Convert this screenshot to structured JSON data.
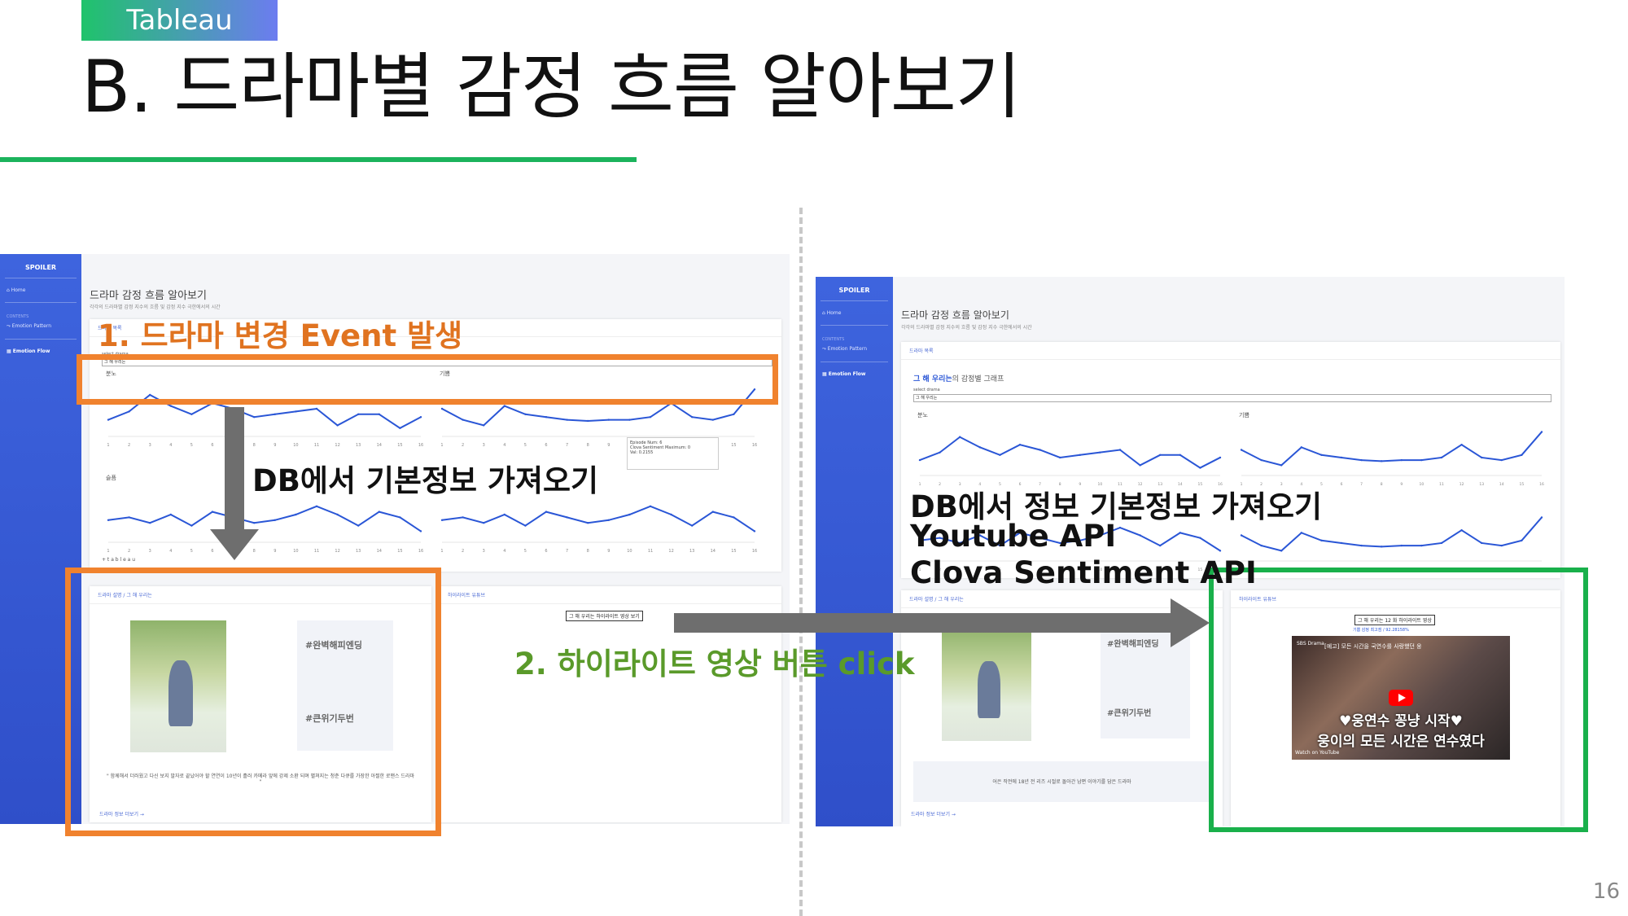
{
  "header": {
    "tag": "Tableau",
    "title": "B. 드라마별 감정 흐름 알아보기",
    "page_number": "16"
  },
  "left_dashboard": {
    "brand": "SPOILER",
    "nav": [
      "Home",
      "CONTENTS",
      "Emotion Pattern",
      "Emotion Flow"
    ],
    "page_title": "드라마 감정 흐름 알아보기",
    "page_subtitle": "각각의 드라마별 감정 지수의 흐름 및 감정 지수 극한에서의 시간",
    "list_header": "드라마 목록",
    "select_label": "select drama",
    "select_value": "그 해 우리는",
    "chart_labels": [
      "분노",
      "기쁨",
      "슬픔"
    ],
    "tooltip": [
      "Episode Num: 6",
      "Clova Sentiment Maximum: 0",
      "Val: 0.2155"
    ],
    "x_ticks": [
      "1",
      "2",
      "3",
      "4",
      "5",
      "6",
      "7",
      "8",
      "9",
      "10",
      "11",
      "12",
      "13",
      "14",
      "15",
      "16"
    ],
    "tableau_logo": "+ t a b l e a u",
    "desc_header": "드라마 설명 / 그 해 우리는",
    "highlight_header": "하이라이트 유튜브",
    "highlight_button": "그 해 우리는 하이라이트 영상 보기",
    "hashtags": [
      "#완벽해피엔딩",
      "#큰위기두번"
    ],
    "description": "\" 함께해서 더러웠고 다신 보지 말자로 끝났어야 할 연연이 10년이 흘러 카메라 앞에 강제 소환 되며 펼쳐지는 청춘 다큐를 가장한 아찔한 로맨스 드라마 \"",
    "more_link": "드라마 정보 더보기 →"
  },
  "right_dashboard": {
    "brand": "SPOILER",
    "nav": [
      "Home",
      "CONTENTS",
      "Emotion Pattern",
      "Emotion Flow"
    ],
    "page_title": "드라마 감정 흐름 알아보기",
    "page_subtitle": "각각의 드라마별 감정 지수의 흐름 및 감정 지수 극한에서의 시간",
    "list_header": "드라마 목록",
    "graph_title_bold": "그 해 우리는",
    "graph_title_rest": "의 감정별 그래프",
    "select_label": "select drama",
    "select_value": "그 해 우리는",
    "chart_labels": [
      "분노",
      "기쁨"
    ],
    "desc_header": "드라마 설명 / 그 해 우리는",
    "highlight_header": "하이라이트 유튜브",
    "highlight_button": "그 해 우리는 12 화 하이라이트 영상",
    "highlight_meta": "기쁨 감정 최고점 / 92.28158%",
    "hashtags": [
      "#완벽해피엔딩",
      "#큰위기두번"
    ],
    "description": "어은 작전에 18년 전 리즈 시절로 돌아간 남편 이야기를 담은 드라마",
    "more_link": "드라마 정보 더보기 →",
    "video": {
      "channel": "SBS Drama",
      "top_text": "[예고] 모든 시간을 국연수를 사랑했던 웅",
      "caption1": "♥웅연수 꽁냥 시작♥",
      "caption2": "웅이의 모든 시간은 연수였다",
      "watch_on": "Watch on YouTube"
    }
  },
  "annotations": {
    "event": "1. 드라마 변경 Event 발생",
    "db_left": "DB에서 기본정보 가져오기",
    "highlight_click": "2. 하이라이트 영상 버튼 click",
    "db_right_1": "DB에서 정보 기본정보 가져오기",
    "db_right_2": "Youtube API",
    "db_right_3": "Clova Sentiment API"
  },
  "colors": {
    "sidebar": "#3e64de",
    "line": "#2a56d6",
    "orange": "#f0822e",
    "green": "#19b04b",
    "annotation_orange": "#e07320",
    "annotation_green": "#5a9a2a",
    "header_green": "#1bb35c"
  },
  "chart_data": [
    {
      "type": "line",
      "title": "분노",
      "x": [
        1,
        2,
        3,
        4,
        5,
        6,
        7,
        8,
        9,
        10,
        11,
        12,
        13,
        14,
        15,
        16
      ],
      "values": [
        0.3,
        0.45,
        0.75,
        0.55,
        0.4,
        0.6,
        0.5,
        0.35,
        0.4,
        0.45,
        0.5,
        0.2,
        0.4,
        0.4,
        0.15,
        0.35
      ]
    },
    {
      "type": "line",
      "title": "기쁨",
      "x": [
        1,
        2,
        3,
        4,
        5,
        6,
        7,
        8,
        9,
        10,
        11,
        12,
        13,
        14,
        15,
        16
      ],
      "values": [
        0.5,
        0.3,
        0.2,
        0.55,
        0.4,
        0.35,
        0.3,
        0.28,
        0.3,
        0.3,
        0.35,
        0.6,
        0.35,
        0.3,
        0.4,
        0.85
      ]
    },
    {
      "type": "line",
      "title": "슬픔",
      "x": [
        1,
        2,
        3,
        4,
        5,
        6,
        7,
        8,
        9,
        10,
        11,
        12,
        13,
        14,
        15,
        16
      ],
      "values": [
        0.4,
        0.45,
        0.35,
        0.5,
        0.3,
        0.55,
        0.45,
        0.35,
        0.4,
        0.5,
        0.65,
        0.5,
        0.3,
        0.55,
        0.45,
        0.2
      ]
    }
  ]
}
